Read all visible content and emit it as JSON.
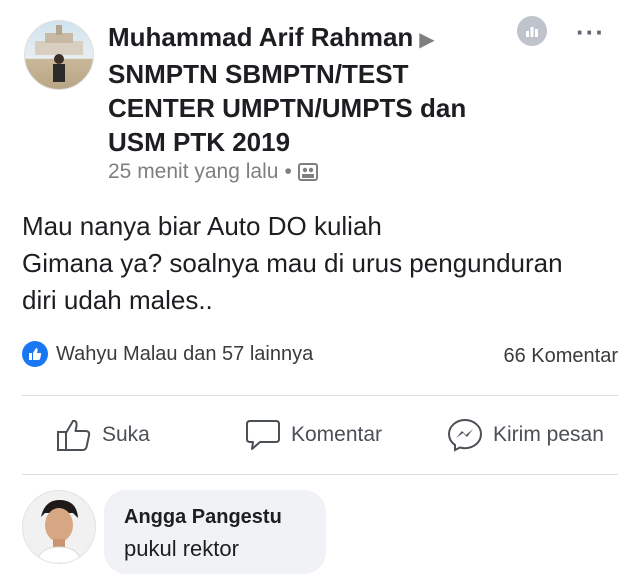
{
  "post": {
    "author": "Muhammad Arif Rahman",
    "group_line1": "SNMPTN SBMPTN/TEST",
    "group_line2": "CENTER UMPTN/UMPTS dan",
    "group_line3": "USM PTK 2019",
    "timestamp": "25 menit yang lalu",
    "separator": "•",
    "body_lines": [
      "Mau nanya biar Auto DO kuliah",
      "Gimana ya? soalnya mau di urus pengunduran",
      "diri udah males.."
    ]
  },
  "stats": {
    "reactions_text": "Wahyu Malau dan 57 lainnya",
    "comments_text": "66 Komentar"
  },
  "actions": {
    "like_label": "Suka",
    "comment_label": "Komentar",
    "message_label": "Kirim pesan"
  },
  "comment": {
    "author": "Angga Pangestu",
    "text": "pukul rektor"
  },
  "colors": {
    "accent": "#1877f2",
    "muted": "#7f7f7f",
    "bubble": "#f0f2f5"
  },
  "icons": [
    "insights-icon",
    "more-icon",
    "group-icon",
    "like-icon",
    "comment-icon",
    "messenger-icon"
  ]
}
